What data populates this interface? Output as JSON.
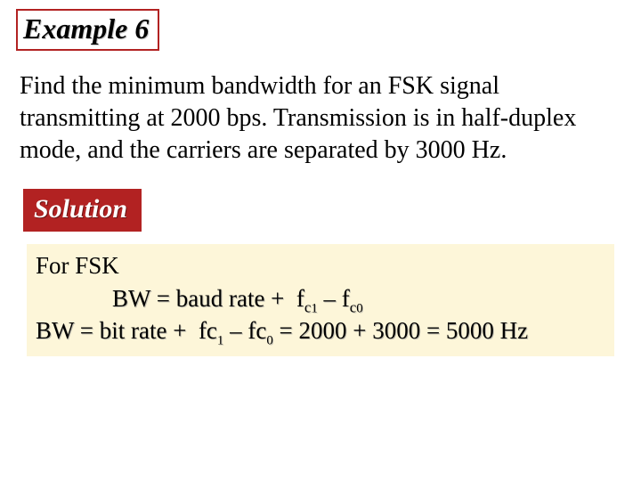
{
  "header": {
    "label": "Example 6"
  },
  "problem": {
    "text": "Find the minimum bandwidth for an FSK signal transmitting at 2000 bps. Transmission is in half-duplex mode, and the carriers are separated by 3000 Hz."
  },
  "solution": {
    "label": "Solution"
  },
  "work": {
    "line1": "For FSK",
    "line2_pre": "BW = baud rate + ",
    "line2_f1": "f",
    "line2_s1a": "c",
    "line2_s1b": "1",
    "line2_mid": " – ",
    "line2_f2": "f",
    "line2_s2a": "c",
    "line2_s2b": "0",
    "line3_pre": "BW = bit rate + ",
    "line3_f1": "fc",
    "line3_s1": "1",
    "line3_mid": " – ",
    "line3_f2": "fc",
    "line3_s2": "0",
    "line3_rest": " = 2000 + 3000 = 5000 Hz"
  }
}
